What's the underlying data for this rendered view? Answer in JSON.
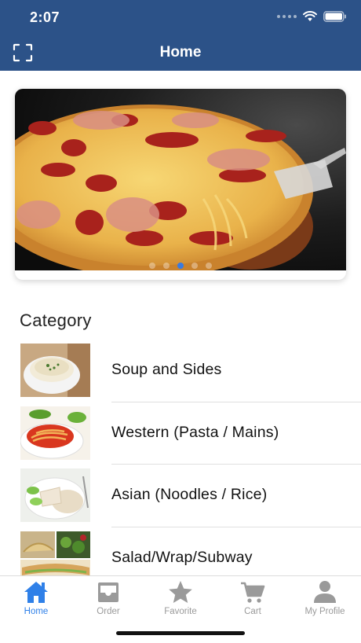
{
  "status_bar": {
    "time": "2:07"
  },
  "header": {
    "title": "Home"
  },
  "category": {
    "heading": "Category",
    "items": [
      {
        "label": "Soup and Sides"
      },
      {
        "label": "Western (Pasta / Mains)"
      },
      {
        "label": "Asian (Noodles / Rice)"
      },
      {
        "label": "Salad/Wrap/Subway"
      }
    ]
  },
  "banner": {
    "page_count": 5,
    "active_page": 3
  },
  "tabbar": {
    "items": [
      {
        "label": "Home",
        "icon": "home-icon",
        "active": true
      },
      {
        "label": "Order",
        "icon": "inbox-icon",
        "active": false
      },
      {
        "label": "Favorite",
        "icon": "star-icon",
        "active": false
      },
      {
        "label": "Cart",
        "icon": "cart-icon",
        "active": false
      },
      {
        "label": "My Profile",
        "icon": "person-icon",
        "active": false
      }
    ]
  },
  "colors": {
    "header_bg": "#2c5288",
    "accent": "#2f80e8",
    "inactive": "#9a9a9a"
  }
}
